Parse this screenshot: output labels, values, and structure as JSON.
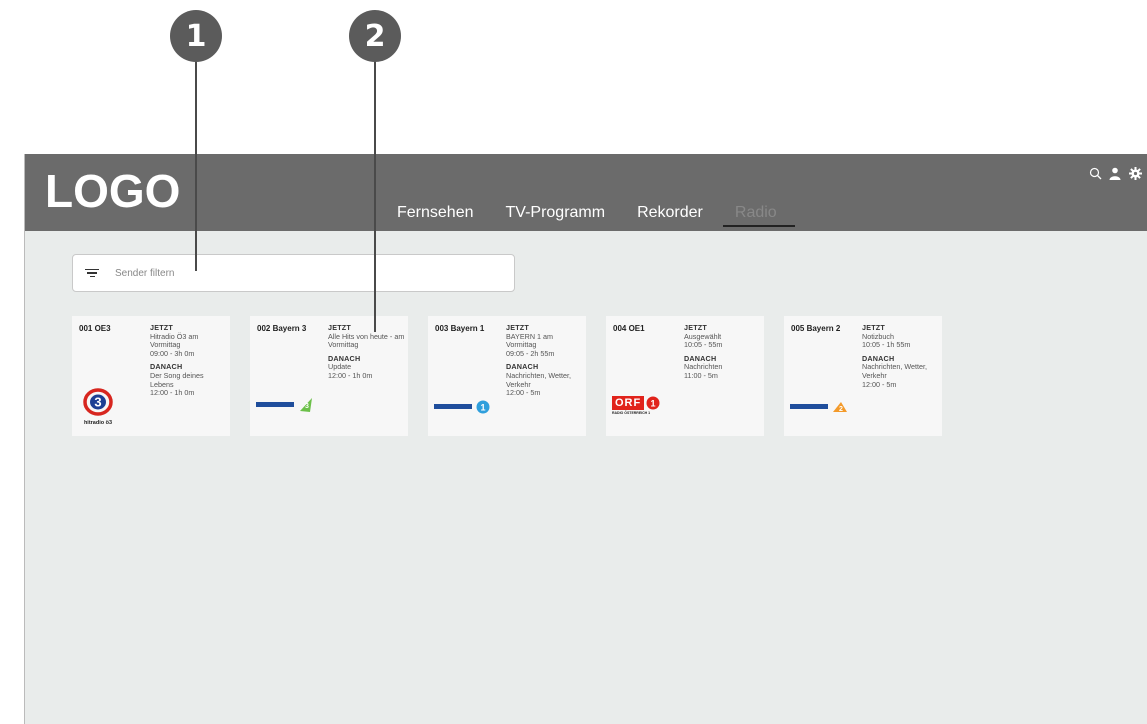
{
  "callouts": [
    "1",
    "2"
  ],
  "header": {
    "logo": "LOGO",
    "nav": [
      "Fernsehen",
      "TV-Programm",
      "Rekorder",
      "Radio"
    ],
    "active_nav": "Radio",
    "icons": [
      "search-icon",
      "user-icon",
      "gear-icon"
    ]
  },
  "filter": {
    "placeholder": "Sender filtern",
    "icon": "filter-icon"
  },
  "colors": {
    "header_bg": "#6b6b6b",
    "content_bg": "#e9eceb",
    "card_bg": "#f7f7f7",
    "orf_red": "#e1231b",
    "bayern_blue": "#1f4e9c"
  },
  "channels": [
    {
      "name": "001 OE3",
      "now_label": "JETZT",
      "now_title": "Hitradio Ö3 am Vormittag",
      "now_time": "09:00 - 3h 0m",
      "next_label": "DANACH",
      "next_title": "Der Song deines Lebens",
      "next_time": "12:00 - 1h 0m",
      "logo_text": "hitradio ö3"
    },
    {
      "name": "002 Bayern 3",
      "now_label": "JETZT",
      "now_title": "Alle Hits von heute - am Vormittag",
      "now_time": "",
      "next_label": "DANACH",
      "next_title": "Update",
      "next_time": "12:00 - 1h 0m"
    },
    {
      "name": "003 Bayern 1",
      "now_label": "JETZT",
      "now_title": "BAYERN 1 am Vormittag",
      "now_time": "09:05 - 2h 55m",
      "next_label": "DANACH",
      "next_title": "Nachrichten, Wetter, Verkehr",
      "next_time": "12:00 - 5m"
    },
    {
      "name": "004 OE1",
      "now_label": "JETZT",
      "now_title": "Ausgewählt",
      "now_time": "10:05 - 55m",
      "next_label": "DANACH",
      "next_title": "Nachrichten",
      "next_time": "11:00 - 5m",
      "logo_text": "ORF",
      "logo_subtext": "RADIO ÖSTERREICH 1"
    },
    {
      "name": "005 Bayern 2",
      "now_label": "JETZT",
      "now_title": "Notizbuch",
      "now_time": "10:05 - 1h 55m",
      "next_label": "DANACH",
      "next_title": "Nachrichten, Wetter, Verkehr",
      "next_time": "12:00 - 5m"
    }
  ]
}
